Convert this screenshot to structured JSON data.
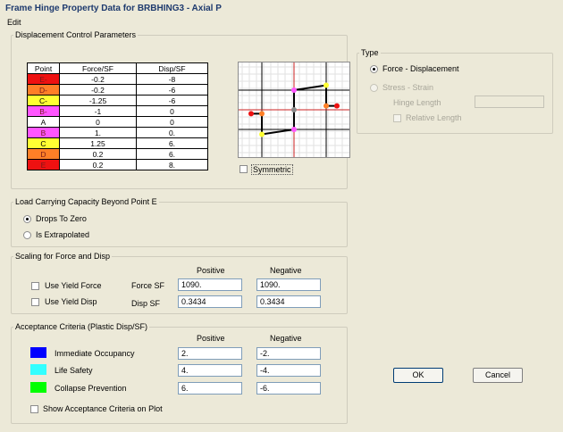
{
  "window": {
    "title": "Frame Hinge Property Data for BRBHING3 - Axial P"
  },
  "menu": {
    "edit": "Edit"
  },
  "displacement": {
    "group_title": "Displacement Control Parameters",
    "headers": [
      "Point",
      "Force/SF",
      "Disp/SF"
    ],
    "rows": [
      {
        "point": "E-",
        "force": "-0.2",
        "disp": "-8",
        "color": "#ee1111"
      },
      {
        "point": "D-",
        "force": "-0.2",
        "disp": "-6",
        "color": "#ff7f27"
      },
      {
        "point": "C-",
        "force": "-1.25",
        "disp": "-6",
        "color": "#ffff33"
      },
      {
        "point": "B-",
        "force": "-1",
        "disp": "0",
        "color": "#ff55ff"
      },
      {
        "point": "A",
        "force": "0",
        "disp": "0",
        "color": "#ffffff"
      },
      {
        "point": "B",
        "force": "1.",
        "disp": "0.",
        "color": "#ff55ff"
      },
      {
        "point": "C",
        "force": "1.25",
        "disp": "6.",
        "color": "#ffff33"
      },
      {
        "point": "D",
        "force": "0.2",
        "disp": "6.",
        "color": "#ff7f27"
      },
      {
        "point": "E",
        "force": "0.2",
        "disp": "8.",
        "color": "#ee1111"
      }
    ],
    "symmetric_label": "Symmetric"
  },
  "type": {
    "group_title": "Type",
    "force_disp_label": "Force - Displacement",
    "stress_strain_label": "Stress - Strain",
    "hinge_length_label": "Hinge Length",
    "relative_length_label": "Relative Length"
  },
  "capacity": {
    "group_title": "Load Carrying Capacity Beyond Point E",
    "drops_label": "Drops To Zero",
    "extrapolated_label": "Is Extrapolated"
  },
  "scaling": {
    "group_title": "Scaling for Force and Disp",
    "positive_header": "Positive",
    "negative_header": "Negative",
    "yield_force_label": "Use Yield Force",
    "yield_disp_label": "Use Yield Disp",
    "force_sf_label": "Force SF",
    "disp_sf_label": "Disp SF",
    "force_sf_pos": "1090.",
    "force_sf_neg": "1090.",
    "disp_sf_pos": "0.3434",
    "disp_sf_neg": "0.3434"
  },
  "acceptance": {
    "group_title": "Acceptance Criteria (Plastic Disp/SF)",
    "positive_header": "Positive",
    "negative_header": "Negative",
    "io_label": "Immediate Occupancy",
    "ls_label": "Life Safety",
    "cp_label": "Collapse Prevention",
    "io_pos": "2.",
    "io_neg": "-2.",
    "ls_pos": "4.",
    "ls_neg": "-4.",
    "cp_pos": "6.",
    "cp_neg": "-6.",
    "io_color": "#0000ff",
    "ls_color": "#33ffff",
    "cp_color": "#00ff00",
    "show_label": "Show Acceptance Criteria on Plot"
  },
  "buttons": {
    "ok": "OK",
    "cancel": "Cancel"
  }
}
